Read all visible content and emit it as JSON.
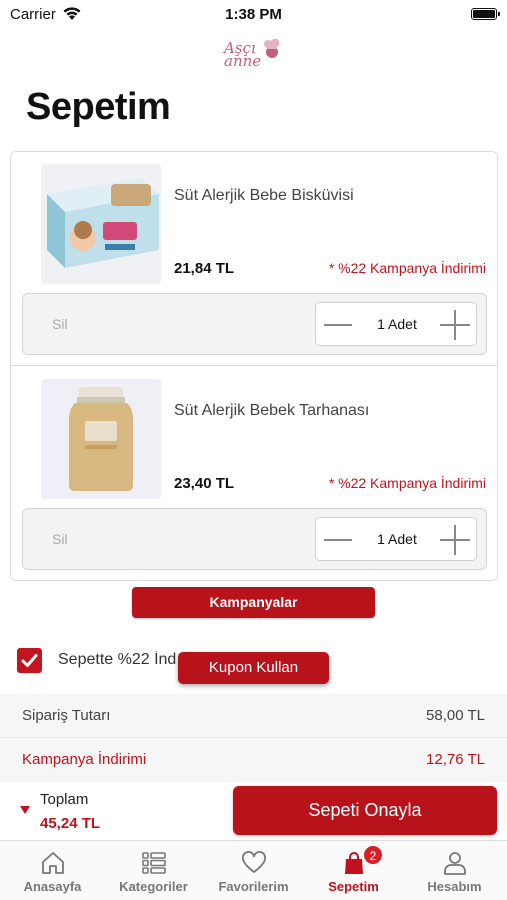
{
  "status_bar": {
    "carrier": "Carrier",
    "time": "1:38 PM"
  },
  "header": {
    "logo_text": "Aşçı anne",
    "title": "Sepetim"
  },
  "cart": {
    "items": [
      {
        "name": "Süt Alerjik Bebe Bisküvisi",
        "price": "21,84 TL",
        "discount": "* %22 Kampanya İndirimi",
        "delete_label": "Sil",
        "quantity": "1 Adet"
      },
      {
        "name": "Süt Alerjik Bebek Tarhanası",
        "price": "23,40 TL",
        "discount": "* %22 Kampanya İndirimi",
        "delete_label": "Sil",
        "quantity": "1 Adet"
      }
    ]
  },
  "campaigns_button": "Kampanyalar",
  "campaign_checkbox": {
    "label": "Sepette %22 İnd",
    "checked": true
  },
  "coupon_button": "Kupon Kullan",
  "summary": {
    "order_total_label": "Sipariş Tutarı",
    "order_total_value": "58,00 TL",
    "discount_label": "Kampanya İndirimi",
    "discount_value": "12,76 TL"
  },
  "total": {
    "label": "Toplam",
    "value": "45,24 TL"
  },
  "confirm_button": "Sepeti Onayla",
  "tabbar": {
    "tabs": [
      {
        "label": "Anasayfa",
        "icon": "home-icon"
      },
      {
        "label": "Kategoriler",
        "icon": "list-icon"
      },
      {
        "label": "Favorilerim",
        "icon": "heart-icon"
      },
      {
        "label": "Sepetim",
        "icon": "bag-icon",
        "badge": "2",
        "active": true
      },
      {
        "label": "Hesabım",
        "icon": "user-icon"
      }
    ]
  },
  "colors": {
    "accent": "#b8131b",
    "discount_text": "#c0111c"
  }
}
